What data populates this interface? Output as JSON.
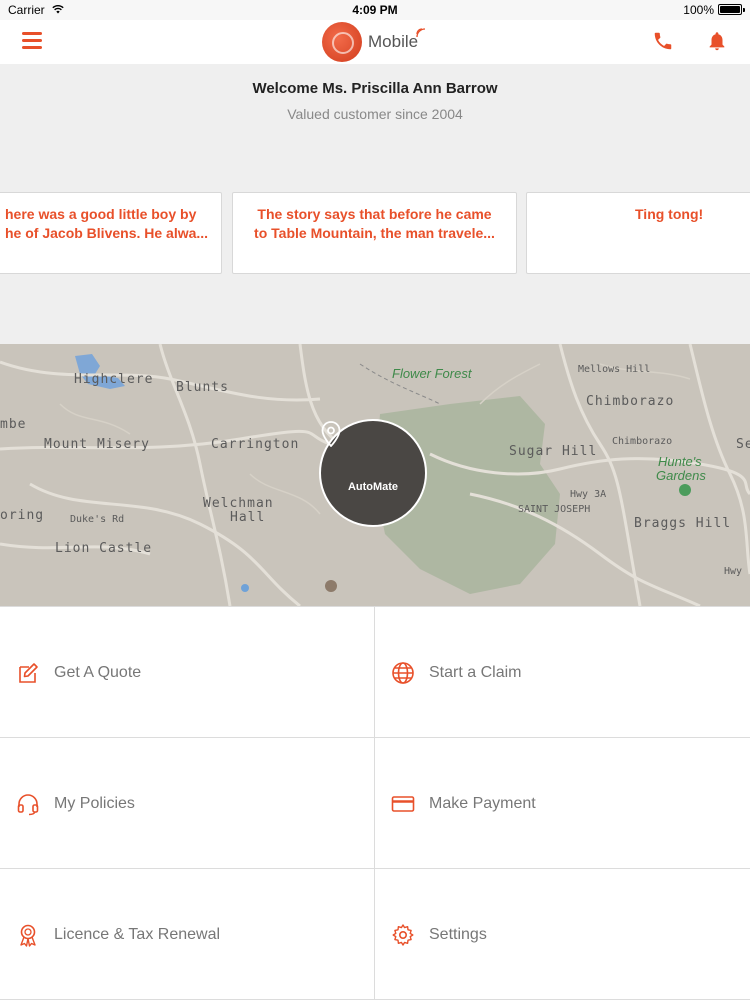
{
  "status_bar": {
    "carrier": "Carrier",
    "time": "4:09 PM",
    "battery": "100%"
  },
  "nav": {
    "brand_text": "Mobile",
    "accent_color": "#e8502a"
  },
  "welcome": {
    "title": "Welcome Ms. Priscilla Ann Barrow",
    "subtitle": "Valued customer since 2004"
  },
  "cards": [
    {
      "line1": "here was a good little boy by",
      "line2": "he of Jacob Blivens. He alwa..."
    },
    {
      "line1": "The story says that before he came",
      "line2": "to Table Mountain, the man travele..."
    },
    {
      "line1": "Ting tong!",
      "line2": ""
    }
  ],
  "map": {
    "button_label": "AutoMate",
    "labels": [
      "Highclere",
      "Blunts",
      "Flower Forest",
      "Mellows Hill",
      "Chimborazo",
      "mbe",
      "Mount Misery",
      "Carrington",
      "Sugar Hill",
      "Chimborazo",
      "Hunte's",
      "Gardens",
      "Hwy 3A",
      "SAINT JOSEPH",
      "oring",
      "Duke's Rd",
      "Welchman",
      "Hall",
      "Braggs Hill",
      "Lion Castle",
      "Hwy",
      "Se"
    ]
  },
  "actions": [
    {
      "label": "Get A Quote",
      "icon": "edit-icon"
    },
    {
      "label": "Start a Claim",
      "icon": "globe-icon"
    },
    {
      "label": "My Policies",
      "icon": "headset-icon"
    },
    {
      "label": "Make Payment",
      "icon": "credit-card-icon"
    },
    {
      "label": "Licence & Tax Renewal",
      "icon": "award-ribbon-icon"
    },
    {
      "label": "Settings",
      "icon": "gear-icon"
    }
  ]
}
